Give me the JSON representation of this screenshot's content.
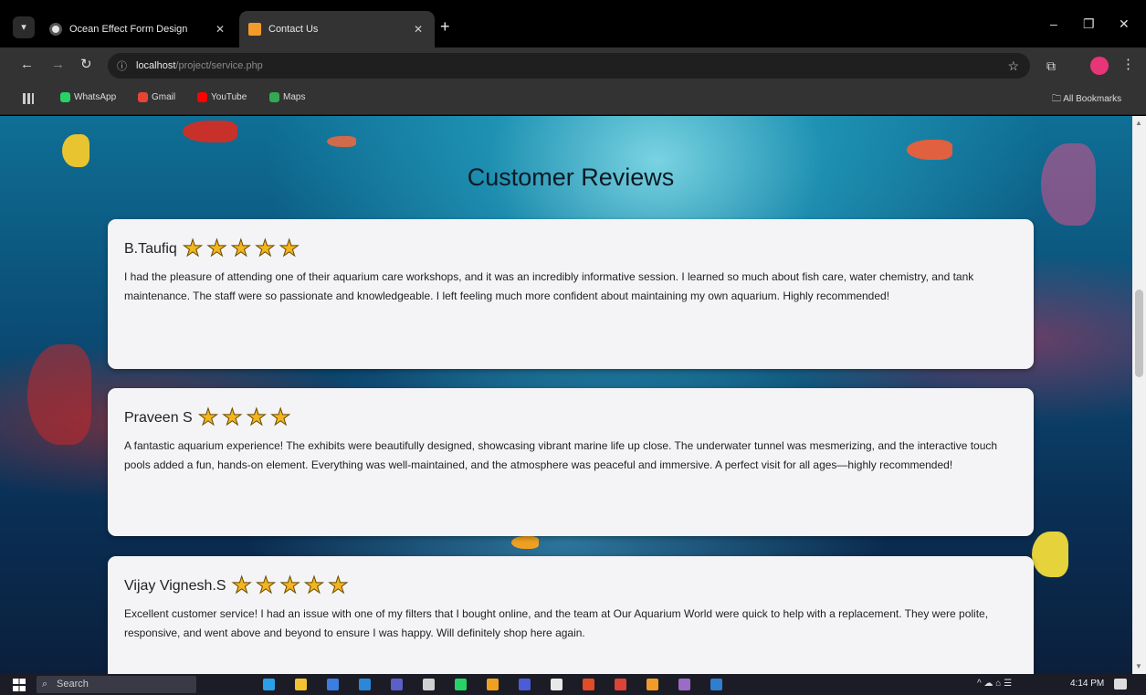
{
  "browser": {
    "tabs": [
      {
        "title": "Ocean Effect Form Design",
        "active": false
      },
      {
        "title": "Contact Us",
        "active": true
      }
    ],
    "new_tab_label": "+",
    "window_controls": {
      "minimize": "–",
      "restore": "❐",
      "close": "✕"
    },
    "url_host": "localhost",
    "url_path": "/project/service.php",
    "bookmarks": [
      {
        "label": "WhatsApp",
        "color": "#25d366"
      },
      {
        "label": "Gmail",
        "color": "#ea4335"
      },
      {
        "label": "YouTube",
        "color": "#ff0000"
      },
      {
        "label": "Maps",
        "color": "#34a853"
      }
    ],
    "all_bookmarks_label": "All Bookmarks"
  },
  "page": {
    "title": "Customer Reviews",
    "reviews": [
      {
        "name": "B.Taufiq",
        "rating": 5,
        "text": "I had the pleasure of attending one of their aquarium care workshops, and it was an incredibly informative session. I learned so much about fish care, water chemistry, and tank maintenance. The staff were so passionate and knowledgeable. I left feeling much more confident about maintaining my own aquarium. Highly recommended!"
      },
      {
        "name": "Praveen S",
        "rating": 4,
        "text": "A fantastic aquarium experience! The exhibits were beautifully designed, showcasing vibrant marine life up close. The underwater tunnel was mesmerizing, and the interactive touch pools added a fun, hands-on element. Everything was well-maintained, and the atmosphere was peaceful and immersive. A perfect visit for all ages—highly recommended!"
      },
      {
        "name": "Vijay Vignesh.S",
        "rating": 5,
        "text": "Excellent customer service! I had an issue with one of my filters that I bought online, and the team at Our Aquarium World were quick to help with a replacement. They were polite, responsive, and went above and beyond to ensure I was happy. Will definitely shop here again."
      }
    ]
  },
  "taskbar": {
    "search_placeholder": "Search",
    "clock": "4:14 PM",
    "app_colors": [
      "#2aa0e8",
      "#f2c233",
      "#3b7de0",
      "#2b88d8",
      "#5b5fc7",
      "#d0d0d0",
      "#25d366",
      "#f0a020",
      "#4a5cd8",
      "#e8e8e8",
      "#e34c26",
      "#db4437",
      "#f39b2a",
      "#9a6cc8",
      "#2f7fd0"
    ]
  }
}
